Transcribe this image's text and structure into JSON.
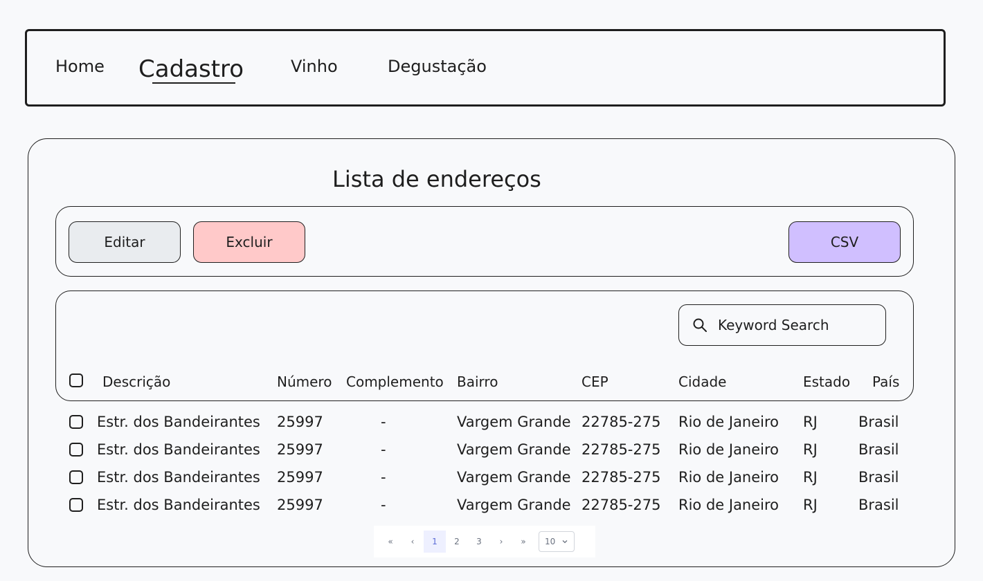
{
  "nav": {
    "items": [
      {
        "label": "Home"
      },
      {
        "label": "Cadastro"
      },
      {
        "label": "Vinho"
      },
      {
        "label": "Degustação"
      }
    ]
  },
  "page": {
    "title": "Lista de endereços"
  },
  "toolbar": {
    "edit_label": "Editar",
    "delete_label": "Excluir",
    "csv_label": "CSV"
  },
  "search": {
    "placeholder": "Keyword Search"
  },
  "table": {
    "columns": [
      "Descrição",
      "Número",
      "Complemento",
      "Bairro",
      "CEP",
      "Cidade",
      "Estado",
      "País"
    ],
    "rows": [
      [
        "Estr. dos Bandeirantes",
        "25997",
        "-",
        "Vargem Grande",
        "22785-275",
        "Rio de Janeiro",
        "RJ",
        "Brasil"
      ],
      [
        "Estr. dos Bandeirantes",
        "25997",
        "-",
        "Vargem Grande",
        "22785-275",
        "Rio de Janeiro",
        "RJ",
        "Brasil"
      ],
      [
        "Estr. dos Bandeirantes",
        "25997",
        "-",
        "Vargem Grande",
        "22785-275",
        "Rio de Janeiro",
        "RJ",
        "Brasil"
      ],
      [
        "Estr. dos Bandeirantes",
        "25997",
        "-",
        "Vargem Grande",
        "22785-275",
        "Rio de Janeiro",
        "RJ",
        "Brasil"
      ]
    ]
  },
  "pagination": {
    "first": "«",
    "prev": "‹",
    "pages": [
      "1",
      "2",
      "3"
    ],
    "current_page": "1",
    "next": "›",
    "last": "»",
    "page_size": "10"
  },
  "colors": {
    "edit": "#e9ecef",
    "delete": "#ffc9c9",
    "csv": "#d0bfff"
  }
}
